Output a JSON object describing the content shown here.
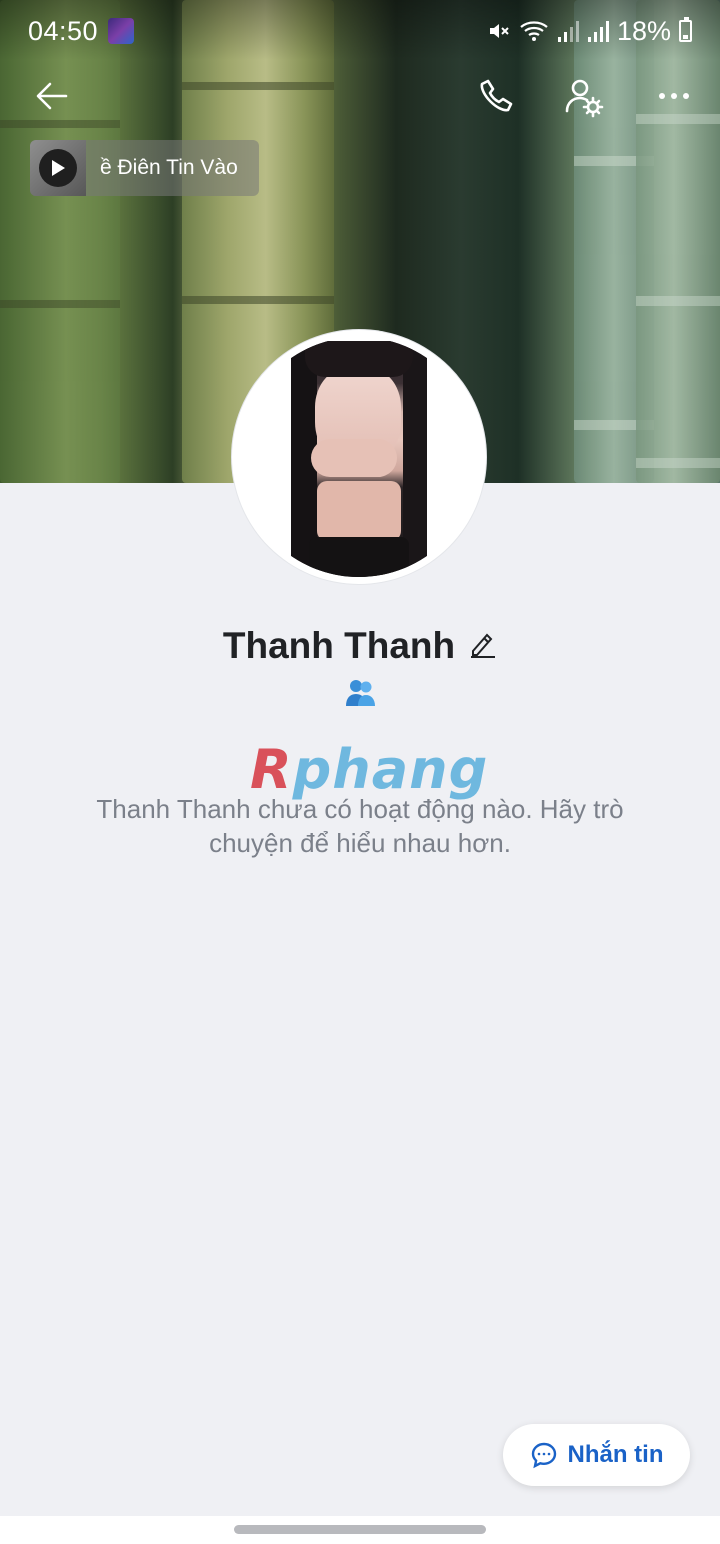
{
  "status_bar": {
    "time": "04:50",
    "battery": "18%",
    "icons": [
      "mute-icon",
      "wifi-icon",
      "signal-icon",
      "signal-icon",
      "battery-icon"
    ]
  },
  "top_bar": {
    "icons": [
      "back-arrow-icon",
      "phone-icon",
      "user-settings-icon",
      "more-dots-icon"
    ]
  },
  "music": {
    "title_visible": "ề Điên Tin Vào"
  },
  "profile": {
    "name": "Thanh Thanh",
    "empty_message": "Thanh Thanh chưa có hoạt động nào. Hãy trò chuyện để hiểu nhau hơn."
  },
  "watermark": {
    "r": "R",
    "rest": "phang"
  },
  "actions": {
    "message_label": "Nhắn tin"
  },
  "colors": {
    "accent": "#1a62c7",
    "background": "#eff0f4",
    "name_text": "#202225",
    "muted_text": "#7b808a"
  }
}
